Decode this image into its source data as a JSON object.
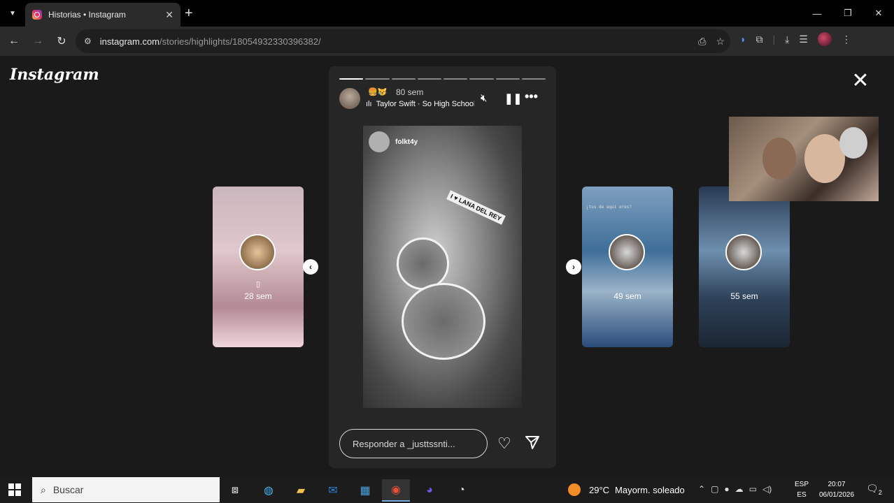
{
  "browser": {
    "tab_title": "Historias • Instagram",
    "url_host": "instagram.com",
    "url_path": "/stories/highlights/18054932330396382/"
  },
  "page": {
    "logo": "Instagram",
    "story": {
      "emoji": "🍔😿",
      "time": "80 sem",
      "music": "Taylor Swift · So High School",
      "media_username": "folkt4y",
      "sign_text": "I ♥ LANA DEL REY",
      "reply_placeholder": "Responder a _justtssnti...",
      "progress_total": 8,
      "progress_done": 1
    },
    "previews": [
      {
        "icon": "▯",
        "time": "28 sem"
      },
      {
        "icon": "",
        "time": "49 sem",
        "top_text": "¿tus de aquí eres?"
      },
      {
        "icon": "",
        "time": "55 sem"
      }
    ]
  },
  "taskbar": {
    "search_placeholder": "Buscar",
    "temp": "29°C",
    "weather": "Mayorm. soleado",
    "lang1": "ESP",
    "lang2": "ES",
    "time": "20:07",
    "date": "06/01/2026",
    "notif_count": "2"
  }
}
